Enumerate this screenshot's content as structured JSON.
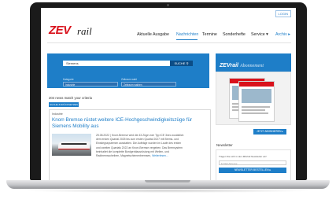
{
  "header": {
    "login_label": "LOGIN",
    "logo_zev": "ZEV",
    "logo_rail": "rail"
  },
  "nav": {
    "items": [
      {
        "label": "Aktuelle Ausgabe"
      },
      {
        "label": "Nachrichten"
      },
      {
        "label": "Termine"
      },
      {
        "label": "Sonderhefte"
      },
      {
        "label": "Service ▾"
      },
      {
        "label": "Archiv ▸"
      }
    ]
  },
  "search": {
    "value": "Siemens",
    "button_label": "SUCHE",
    "category_label": "Kategorie",
    "category_value": "Industrie",
    "period_label": "Zeitraum wahl",
    "period_value": "Zeitraum wahlen"
  },
  "results": {
    "count_text": "204 news match your criteria",
    "reset_label": "SUCHE ZURÜCKSETZEN"
  },
  "article": {
    "category": "Industrie",
    "title": "Knorr-Bremse rüstet weitere ICE-Hochgeschwindigkeitszüge für Siemens Mobility aus",
    "text_lines": [
      "25.08.2022 | Knorr-Bremse wird die 43 Züge vom Typ ICE 3neo zusätzlich",
      "dem ersten Quartal 2025 bis zum ersten Quartal 2027 mit Brems- und",
      "Einstiegssystemen ausstatten. Die Aufträge wurden im Laufe des ersten",
      "und zweiten Quartals 2022 an Knorr-Bremse vergeben. Das Bremsystem",
      "beinhaltet die komplette Bordgerätausrüstung mit Wellen- und",
      "Radbremsscheiben, Magnetschienenbremsen,"
    ],
    "more_label": "Weiterlesen..."
  },
  "sidebar": {
    "abo_logo": "ZEVrail",
    "abo_title": "Abonnement",
    "abo_button": "JETZT ABONNIEREN ▸",
    "newsletter_title": "Newsletter",
    "newsletter_text": "Tragen Sie sich in den ZEVrail Newsletter ein!",
    "email_placeholder": "E-Mail-Adresse",
    "newsletter_button": "NEWSLETTER BESTELLEN ▸"
  }
}
